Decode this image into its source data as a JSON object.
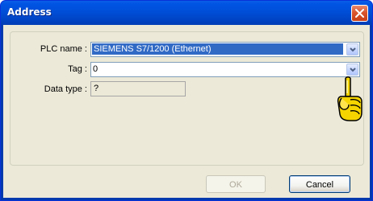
{
  "window": {
    "title": "Address"
  },
  "form": {
    "plc_name": {
      "label": "PLC name :",
      "value": "SIEMENS S7/1200 (Ethernet)"
    },
    "tag": {
      "label": "Tag :",
      "value": "0"
    },
    "data_type": {
      "label": "Data type :",
      "value": "?"
    }
  },
  "buttons": {
    "ok": "OK",
    "cancel": "Cancel"
  },
  "colors": {
    "titlebar": "#0054e3",
    "selection": "#316ac5",
    "close": "#d9552e",
    "pointer_hand": "#f5d400"
  },
  "icons": {
    "close": "close-icon",
    "dropdown": "chevron-down-icon",
    "hint": "pointing-hand-icon"
  }
}
